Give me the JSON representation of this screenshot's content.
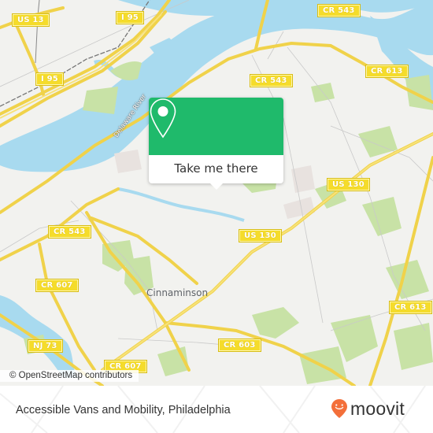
{
  "map": {
    "water_color": "#a8daef",
    "land_color": "#f2f2ef",
    "park_color": "#c8e2a6",
    "road_color": "#f7e06a",
    "shield_color": "#f5dc2b",
    "road_labels": [
      {
        "id": "us13",
        "text": "US 13"
      },
      {
        "id": "i95a",
        "text": "I 95"
      },
      {
        "id": "i95b",
        "text": "I 95"
      },
      {
        "id": "cr543a",
        "text": "CR 543"
      },
      {
        "id": "cr543b",
        "text": "CR 543"
      },
      {
        "id": "cr543c",
        "text": "CR 543"
      },
      {
        "id": "cr613a",
        "text": "CR 613"
      },
      {
        "id": "cr613b",
        "text": "CR 613"
      },
      {
        "id": "us130a",
        "text": "US 130"
      },
      {
        "id": "us130b",
        "text": "US 130"
      },
      {
        "id": "cr607a",
        "text": "CR 607"
      },
      {
        "id": "cr607b",
        "text": "CR 607"
      },
      {
        "id": "nj73",
        "text": "NJ 73"
      },
      {
        "id": "cr603",
        "text": "CR 603"
      }
    ],
    "place_label": "Cinnaminson",
    "river_label": "Delaware River",
    "attribution": "© OpenStreetMap contributors"
  },
  "popup": {
    "accent": "#1fba6b",
    "icon": "location-pin-icon",
    "button_label": "Take me there"
  },
  "footer": {
    "title": "Accessible Vans and Mobility, Philadelphia",
    "logo_text": "moovit",
    "logo_color": "#f36f3a"
  }
}
